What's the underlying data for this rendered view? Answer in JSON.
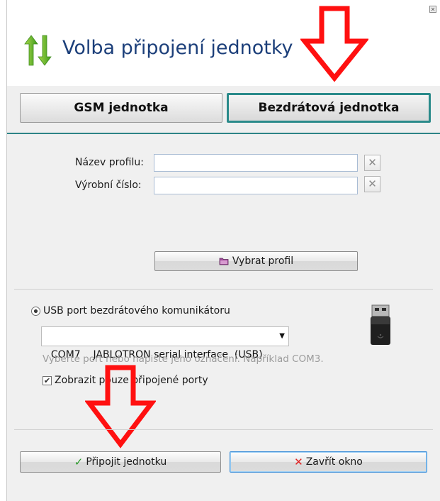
{
  "window": {
    "title": "Volba připojení jednotky"
  },
  "tabs": [
    {
      "label": "GSM jednotka",
      "active": false
    },
    {
      "label": "Bezdrátová jednotka",
      "active": true
    }
  ],
  "profile": {
    "name_label": "Název profilu:",
    "name_value": "",
    "serial_label": "Výrobní číslo:",
    "serial_value": "",
    "select_button": "Vybrat profil"
  },
  "usb": {
    "radio_label": "USB port bezdrátového komunikátoru",
    "port_value": "COM7    JABLOTRON serial interface  (USB)",
    "hint": "Vyberte port nebo napište jeho označení. Například COM3.",
    "only_connected_label": "Zobrazit pouze připojené porty",
    "only_connected_checked": true
  },
  "footer": {
    "connect_label": "Připojit jednotku",
    "close_label": "Zavřít okno"
  },
  "colors": {
    "accent": "#2a8a8a",
    "title": "#1c3f7a",
    "annotation_arrow": "#ff0000",
    "connect_check": "#2a9a2a",
    "close_x": "#e02020"
  }
}
